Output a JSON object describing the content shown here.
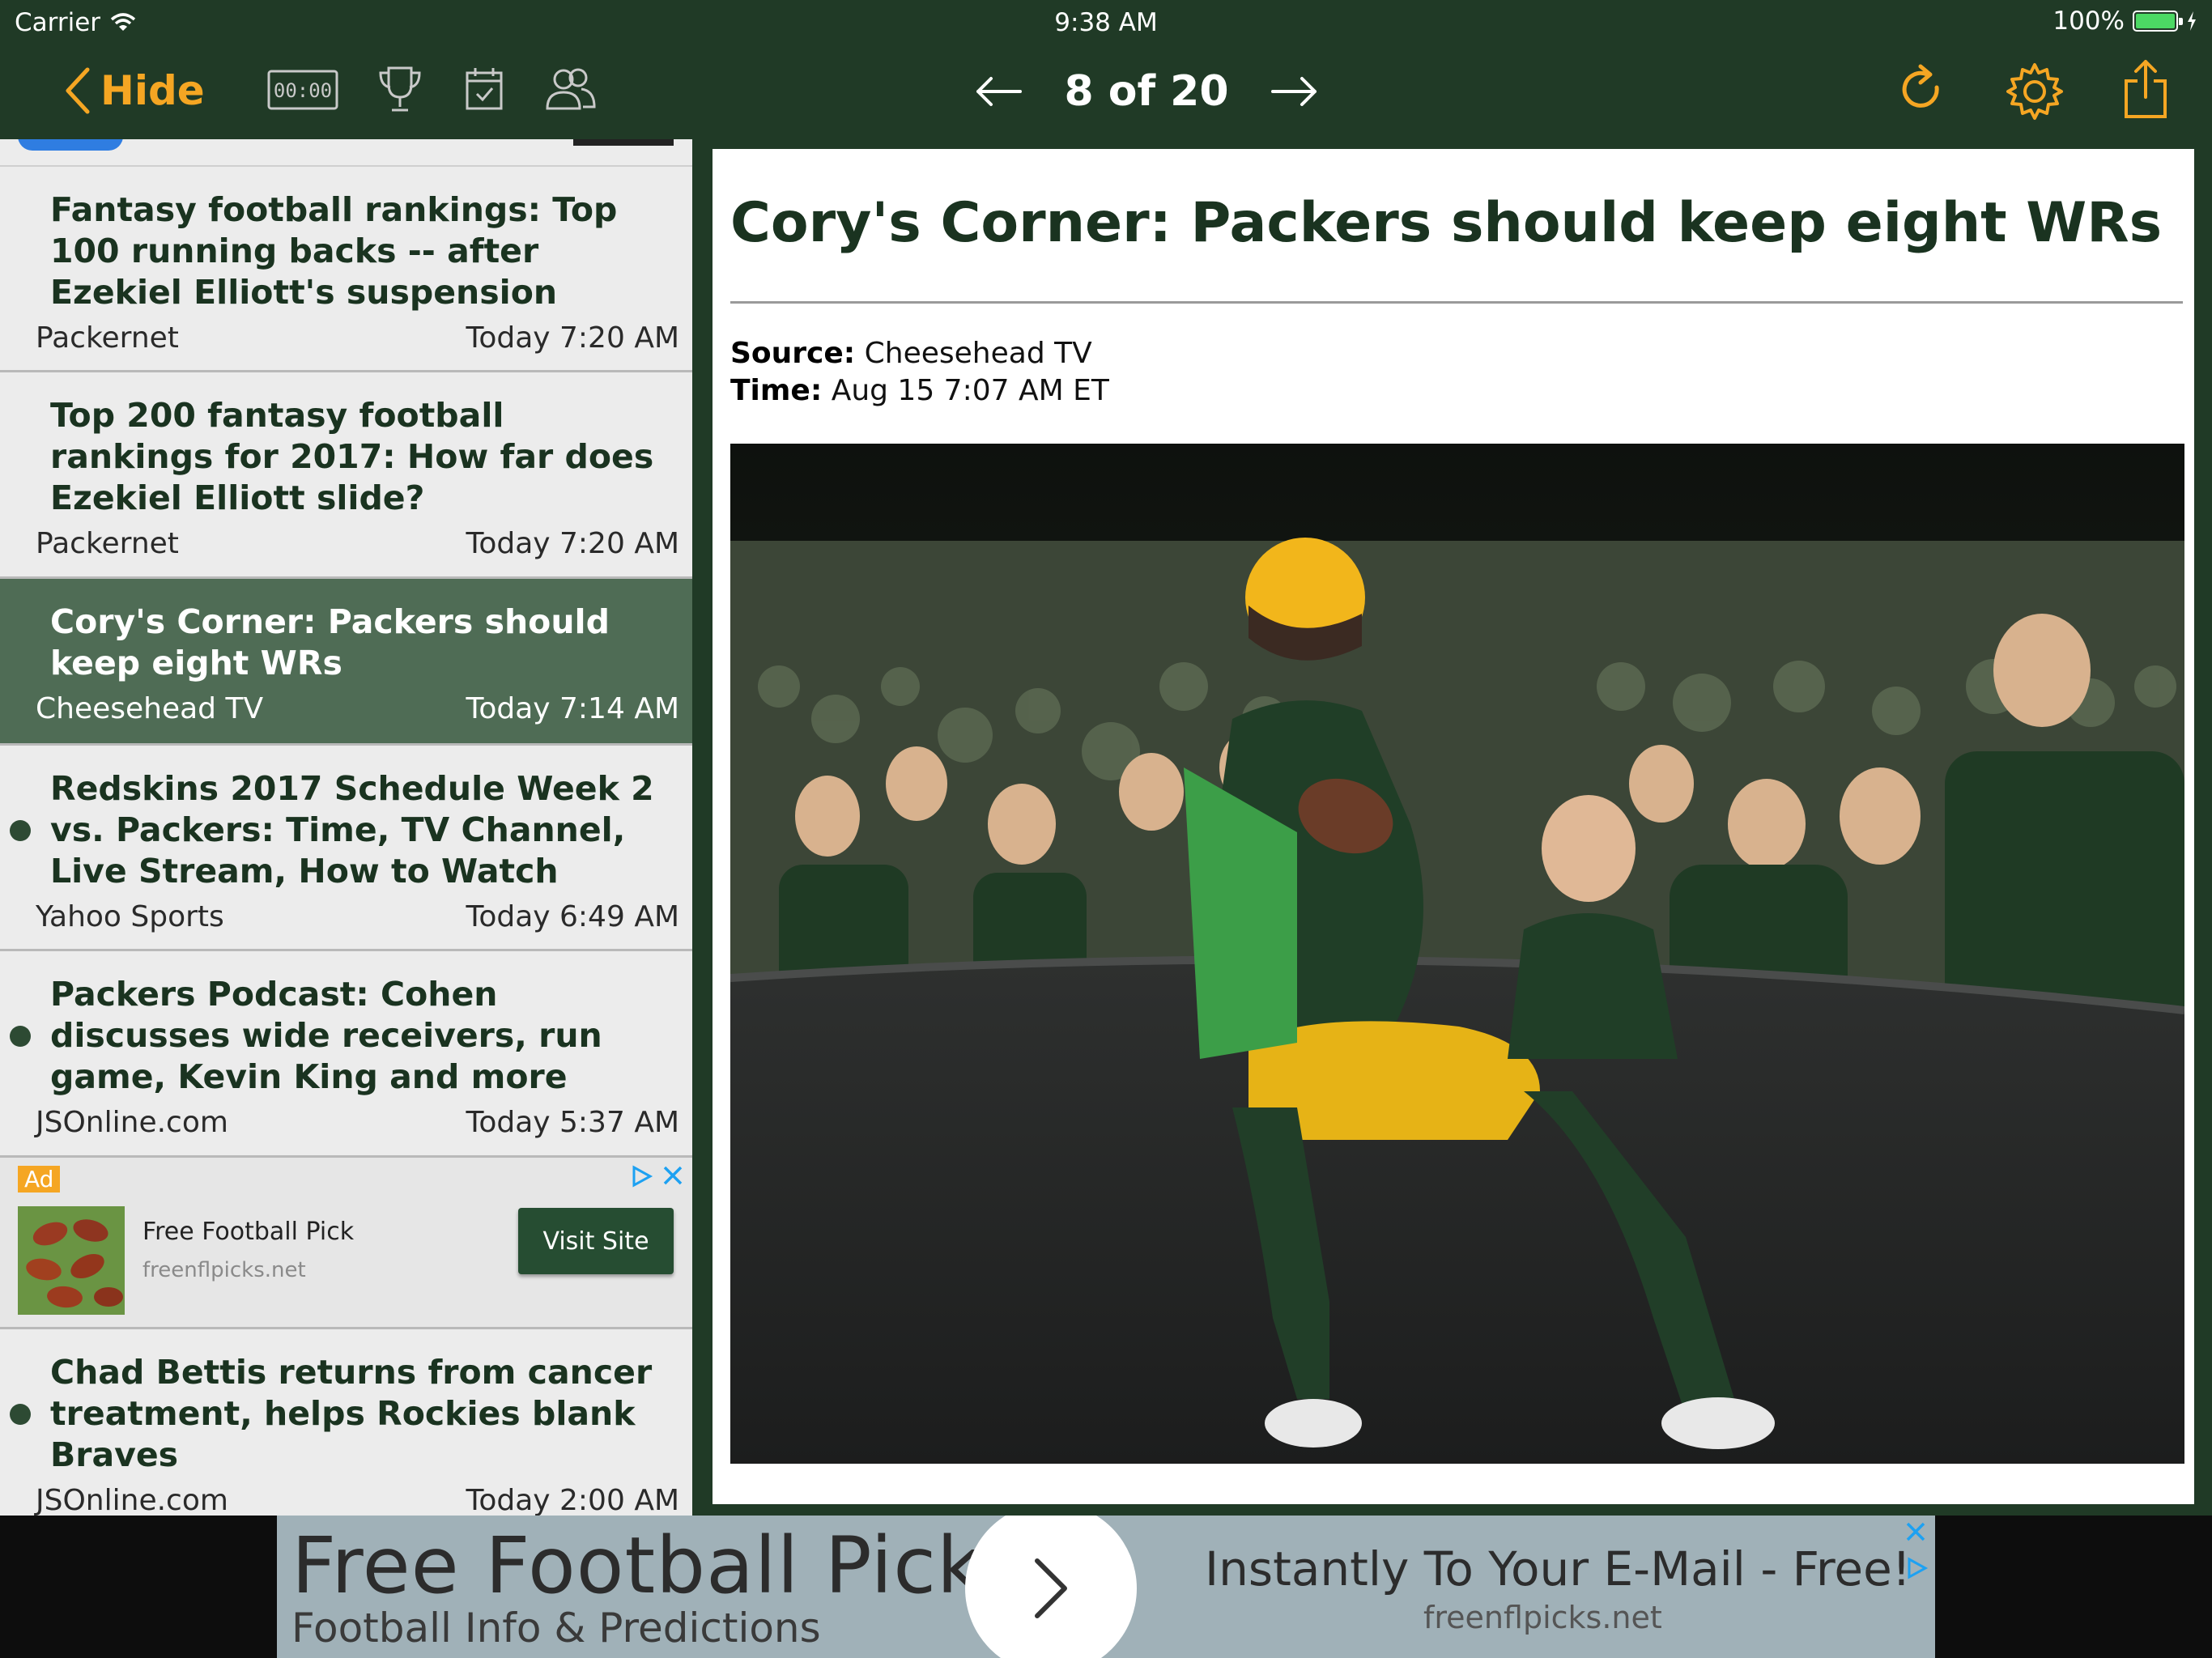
{
  "status_bar": {
    "carrier": "Carrier",
    "time": "9:38 AM",
    "battery": "100%",
    "battery_color": "#4cd964"
  },
  "nav": {
    "hide_label": "Hide",
    "timer_label": "00:00",
    "position_label": "8 of 20",
    "accent_color": "#f5a623",
    "icons": [
      "back-chevron-icon",
      "timer-icon",
      "trophy-icon",
      "calendar-icon",
      "people-icon",
      "prev-arrow-icon",
      "next-arrow-icon",
      "refresh-icon",
      "gear-icon",
      "share-icon"
    ]
  },
  "list": {
    "items": [
      {
        "title": "Fantasy football rankings: Top 100 running backs -- after Ezekiel Elliott's suspension",
        "source": "Packernet",
        "time": "Today 7:20 AM",
        "unread": false,
        "selected": false
      },
      {
        "title": "Top 200 fantasy football rankings for 2017: How far does Ezekiel Elliott slide?",
        "source": "Packernet",
        "time": "Today 7:20 AM",
        "unread": false,
        "selected": false
      },
      {
        "title": "Cory's Corner: Packers should keep eight WRs",
        "source": "Cheesehead TV",
        "time": "Today 7:14 AM",
        "unread": false,
        "selected": true
      },
      {
        "title": "Redskins 2017 Schedule Week 2 vs. Packers: Time, TV Channel, Live Stream, How to Watch",
        "source": "Yahoo Sports",
        "time": "Today 6:49 AM",
        "unread": true,
        "selected": false
      },
      {
        "title": "Packers Podcast: Cohen discusses wide receivers, run game, Kevin King and more",
        "source": "JSOnline.com",
        "time": "Today 5:37 AM",
        "unread": true,
        "selected": false
      }
    ],
    "ad": {
      "tag": "Ad",
      "title": "Free Football Pick",
      "url": "freenflpicks.net",
      "button": "Visit Site"
    },
    "last_item": {
      "title": "Chad Bettis returns from cancer treatment, helps Rockies blank Braves",
      "source": "JSOnline.com",
      "time": "Today 2:00 AM",
      "unread": true,
      "selected": false
    }
  },
  "article": {
    "title": "Cory's Corner: Packers should keep eight WRs",
    "source_label": "Source:",
    "source_value": "Cheesehead TV",
    "time_label": "Time:",
    "time_value": "Aug 15 7:07 AM ET",
    "title_color": "#1a3320"
  },
  "banner": {
    "title": "Free Football Pick",
    "subtitle": "Football Info & Predictions",
    "right_line": "Instantly To Your E-Mail - Free!",
    "url": "freenflpicks.net"
  }
}
